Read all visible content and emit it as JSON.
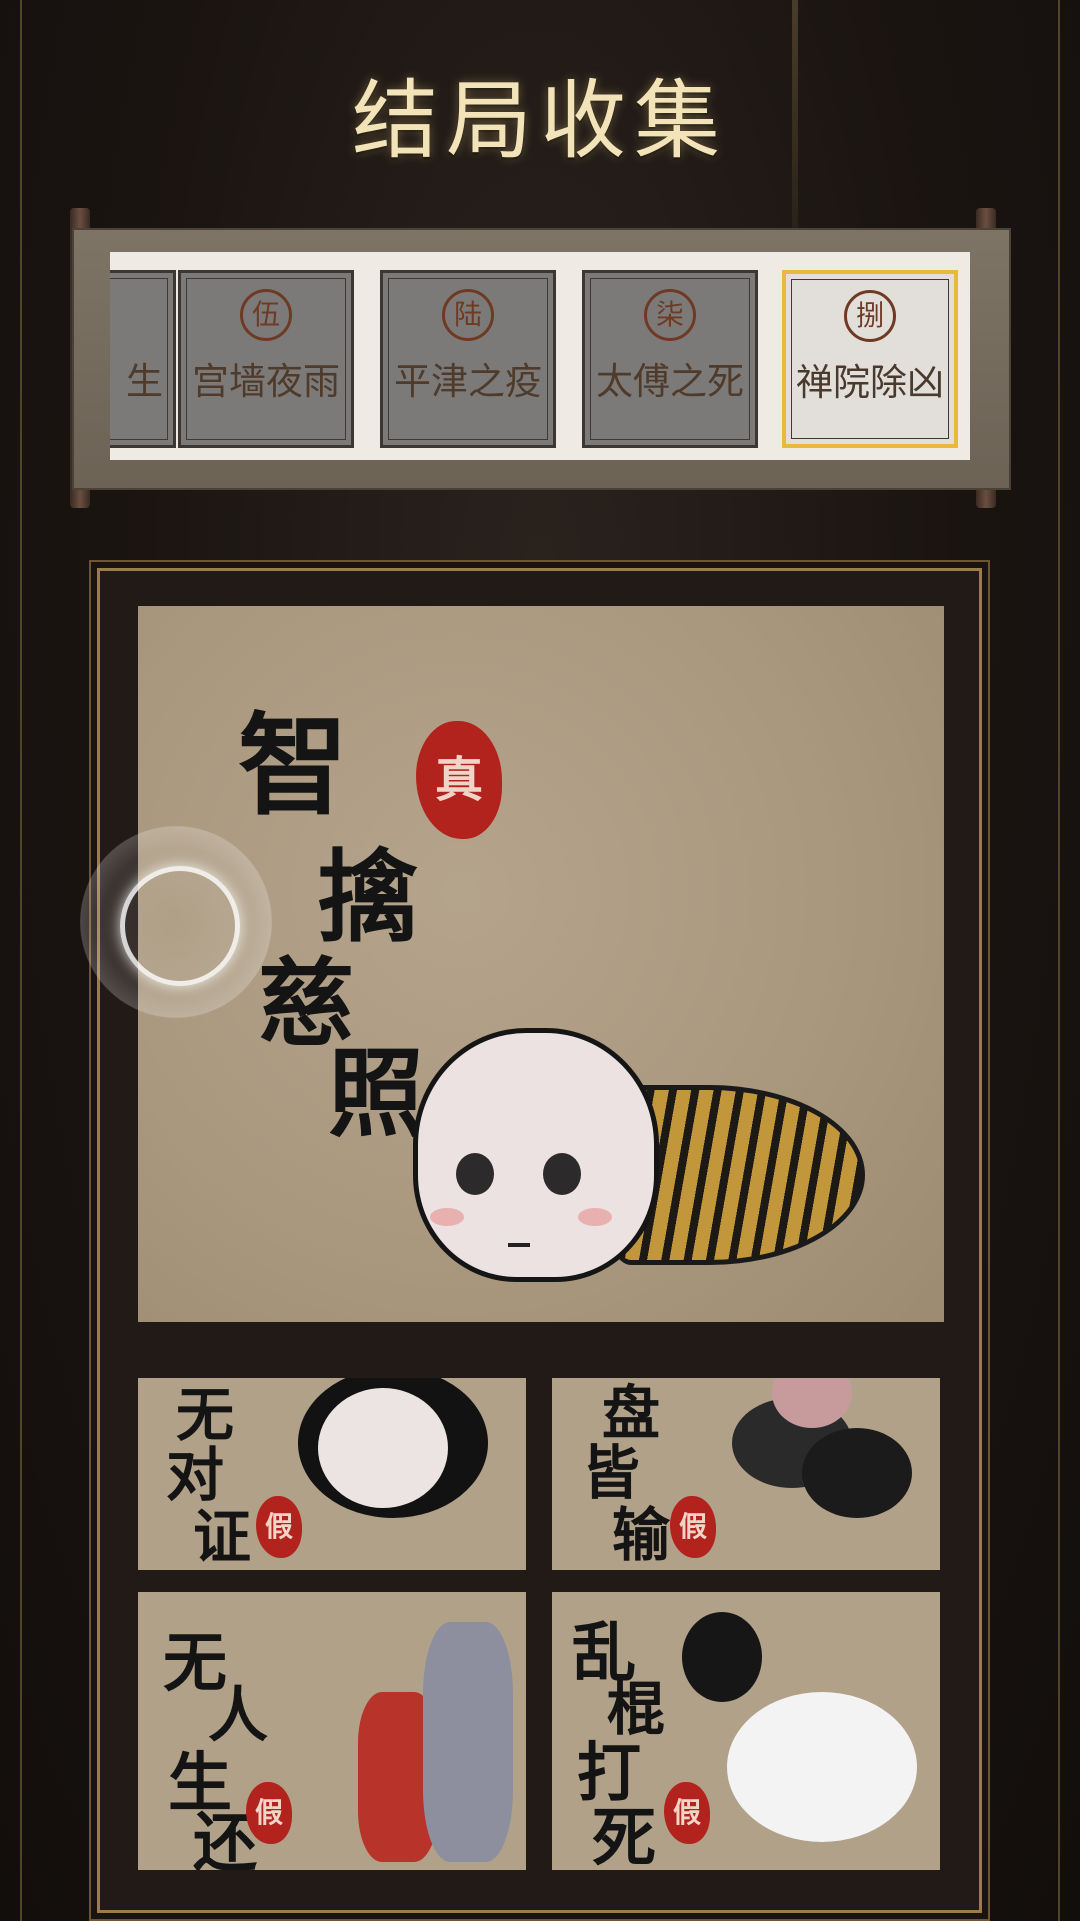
{
  "header": {
    "title": "结局收集"
  },
  "ending_cards": [
    {
      "seal": "",
      "title": "生",
      "selected": false
    },
    {
      "seal": "伍",
      "title": "宫墙夜雨",
      "selected": false
    },
    {
      "seal": "陆",
      "title": "平津之疫",
      "selected": false
    },
    {
      "seal": "柒",
      "title": "太傅之死",
      "selected": false
    },
    {
      "seal": "捌",
      "title": "禅院除凶",
      "selected": true
    }
  ],
  "main_ending": {
    "title_chars": [
      "智",
      "擒",
      "慈",
      "照"
    ],
    "seal": "真"
  },
  "alt_endings": [
    {
      "chars": [
        "无",
        "对",
        "证"
      ],
      "seal": "假"
    },
    {
      "chars": [
        "盘",
        "皆",
        "输"
      ],
      "seal": "假"
    },
    {
      "chars": [
        "无",
        "人",
        "生",
        "还"
      ],
      "seal": "假"
    },
    {
      "chars": [
        "乱",
        "棍",
        "打",
        "死"
      ],
      "seal": "假"
    }
  ],
  "colors": {
    "background": "#1a1411",
    "title": "#f2e4b8",
    "accent_gold": "#e8b93a",
    "seal_red": "#b3231e",
    "paper": "#b1a189"
  }
}
